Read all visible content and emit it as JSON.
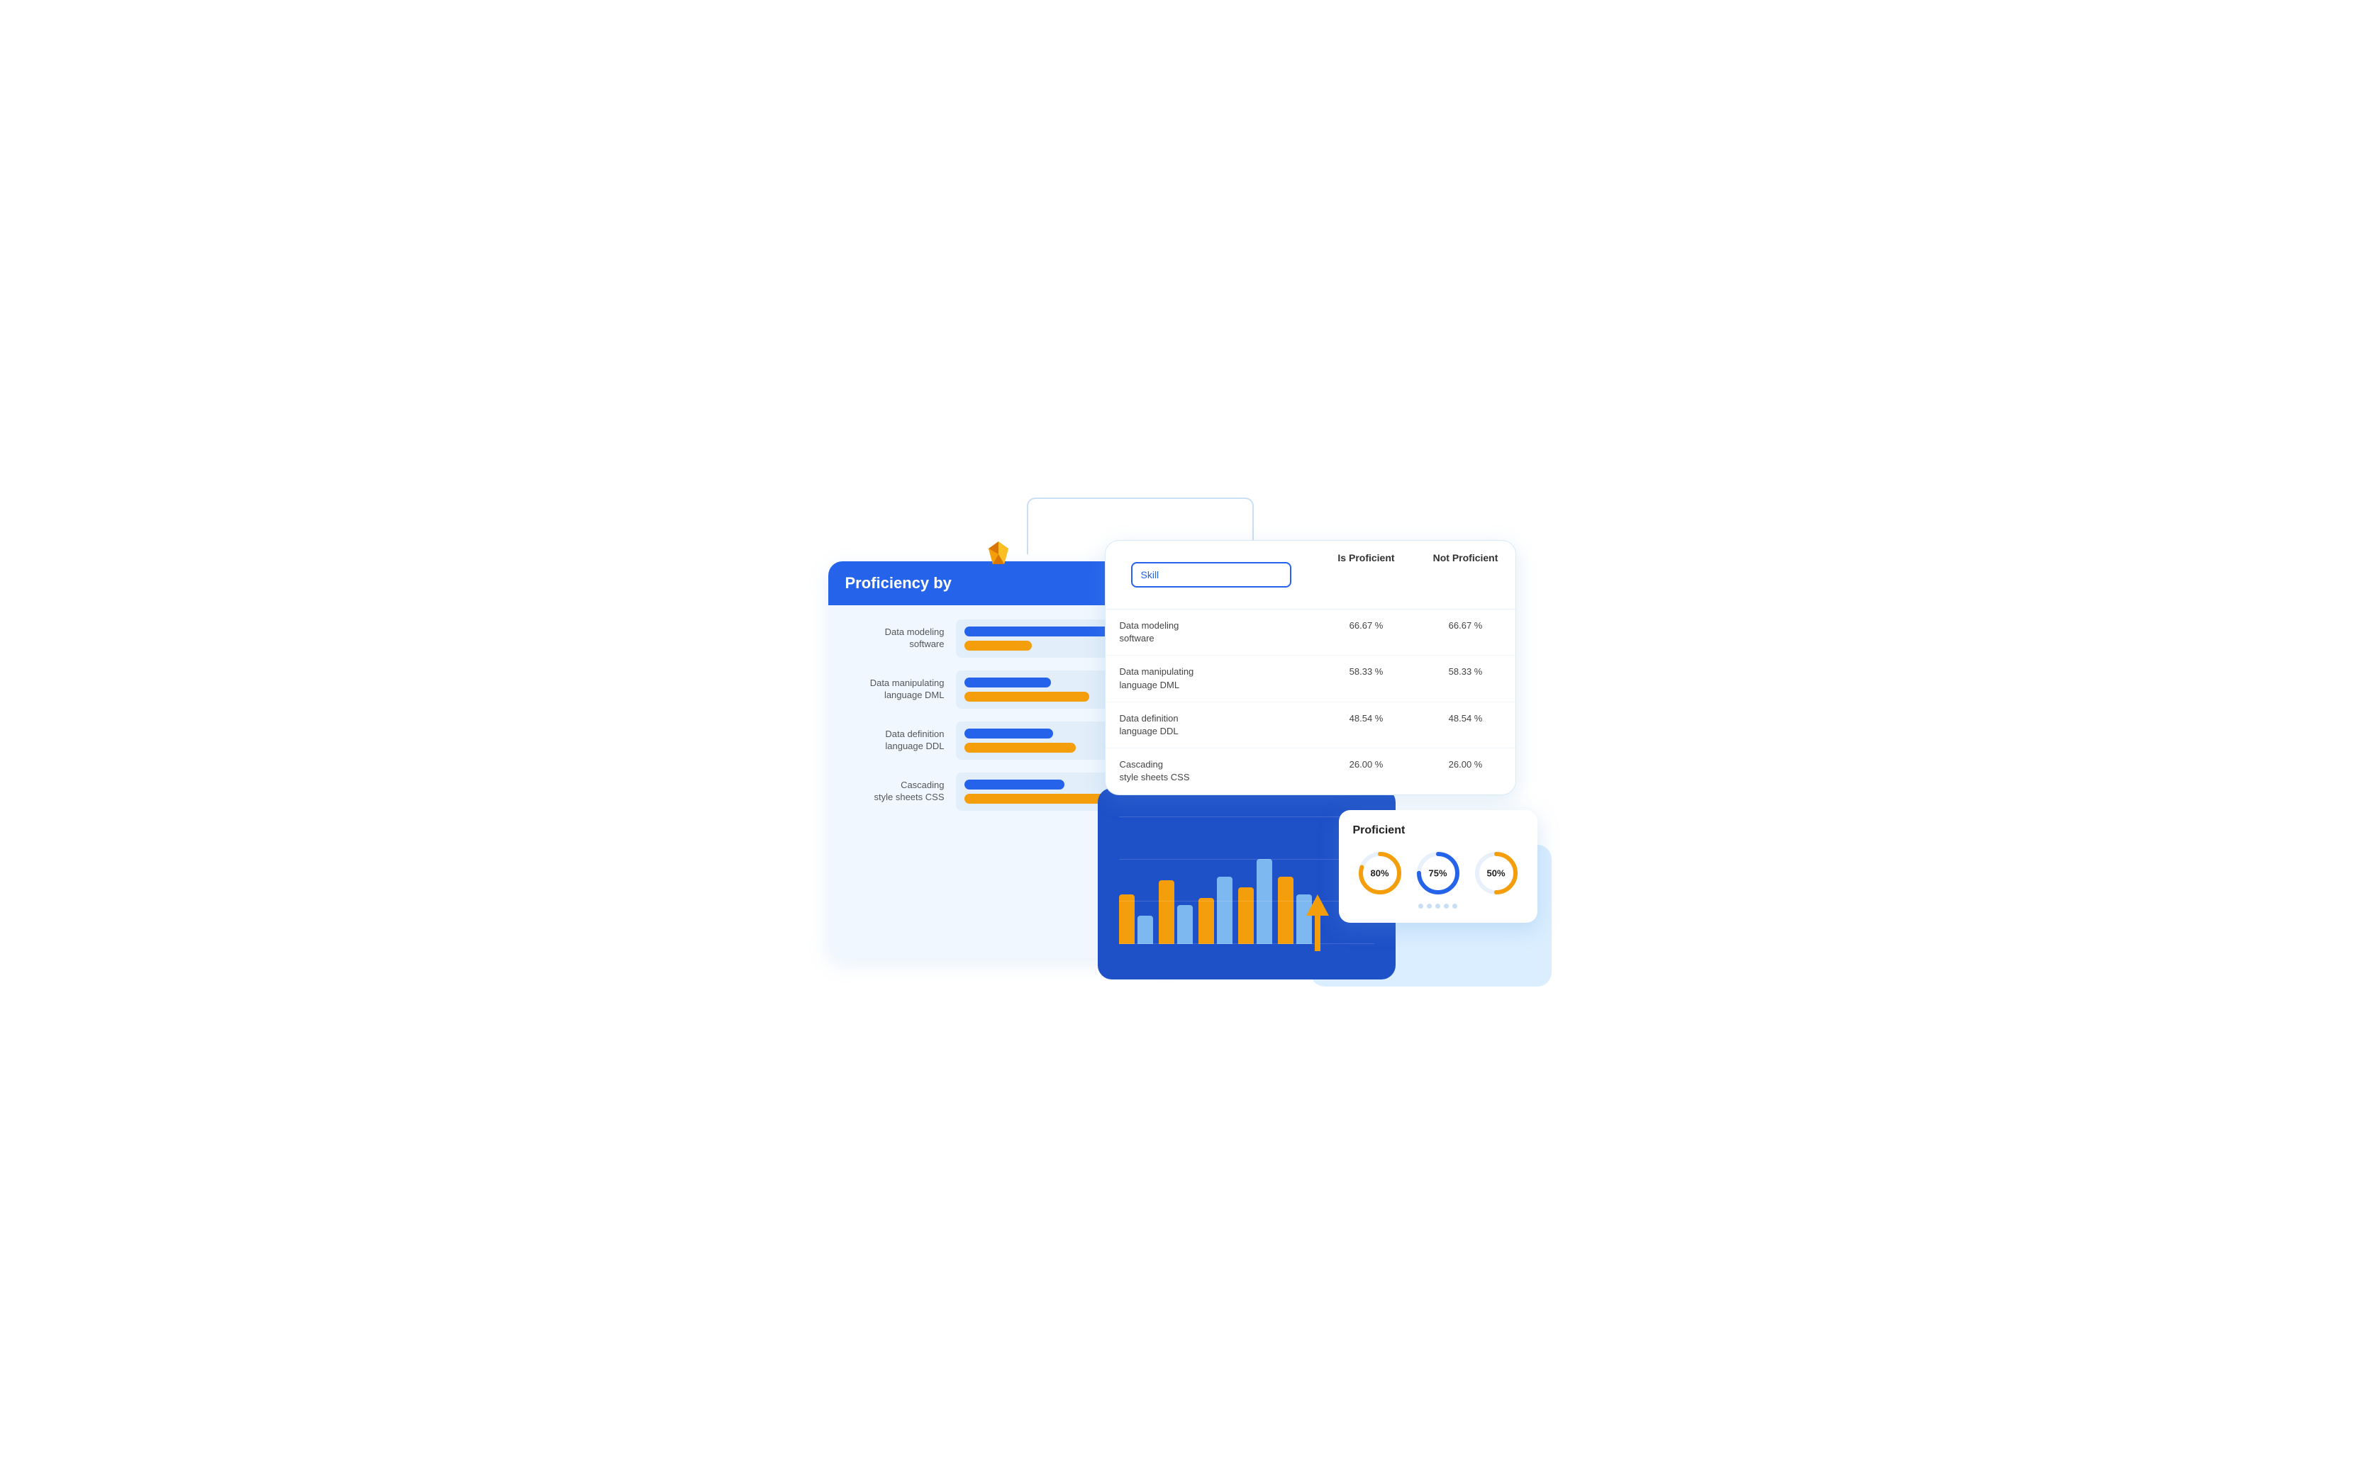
{
  "left_card": {
    "title": "Proficiency by",
    "bars": [
      {
        "label": "Data modeling\nsoftware",
        "blue_width": "75%",
        "orange_width": "35%"
      },
      {
        "label": "Data manipulating\nlanguage DML",
        "blue_width": "45%",
        "orange_width": "65%"
      },
      {
        "label": "Data definition\nlanguage DDL",
        "blue_width": "46%",
        "orange_width": "58%"
      },
      {
        "label": "Cascading\nstyle sheets CSS",
        "blue_width": "52%",
        "orange_width": "80%"
      }
    ]
  },
  "table_card": {
    "skill_placeholder": "Skill",
    "columns": [
      "Is Proficient",
      "Not Proficient"
    ],
    "rows": [
      {
        "skill": "Data modeling\nsoftware",
        "is_proficient": "66.67 %",
        "not_proficient": "66.67 %"
      },
      {
        "skill": "Data manipulating\nlanguage DML",
        "is_proficient": "58.33 %",
        "not_proficient": "58.33 %"
      },
      {
        "skill": "Data definition\nlanguage DDL",
        "is_proficient": "48.54 %",
        "not_proficient": "48.54 %"
      },
      {
        "skill": "Cascading\nstyle sheets CSS",
        "is_proficient": "26.00 %",
        "not_proficient": "26.00 %"
      }
    ]
  },
  "proficient_card": {
    "title": "Proficient",
    "circles": [
      {
        "value": 80,
        "label": "80%",
        "color": "#f59e0b"
      },
      {
        "value": 75,
        "label": "75%",
        "color": "#2563eb"
      },
      {
        "value": 50,
        "label": "50%",
        "color": "#f59e0b"
      }
    ]
  },
  "chart": {
    "bars": [
      {
        "orange": 70,
        "light": 40
      },
      {
        "orange": 90,
        "light": 55
      },
      {
        "orange": 65,
        "light": 85
      },
      {
        "orange": 80,
        "light": 110
      },
      {
        "orange": 95,
        "light": 70
      }
    ]
  }
}
